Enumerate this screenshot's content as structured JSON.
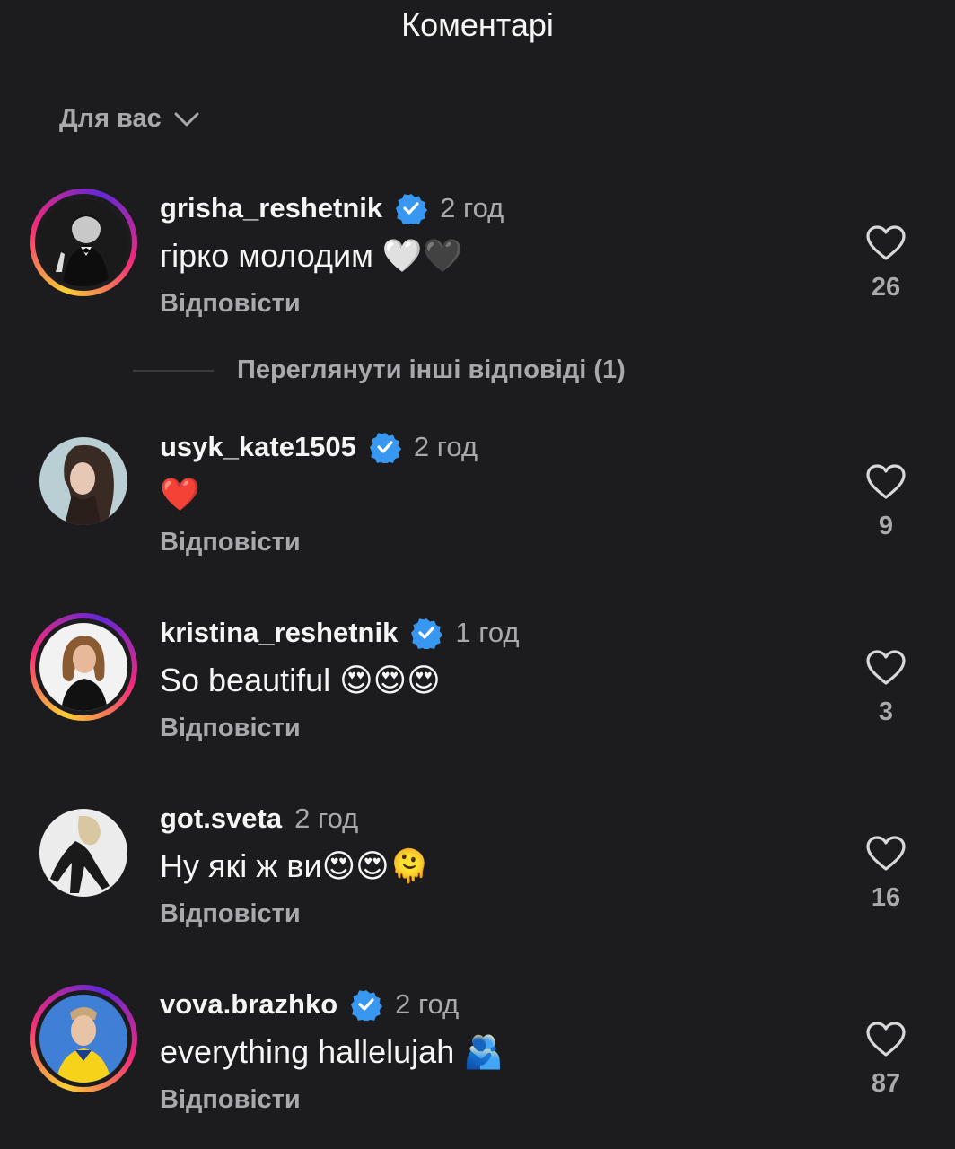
{
  "header": {
    "title": "Коментарі"
  },
  "sort": {
    "label": "Для вас"
  },
  "more_replies": "Переглянути інші відповіді (1)",
  "comments": [
    {
      "username": "grisha_reshetnik",
      "verified": true,
      "time": "2 год",
      "text": "гірко молодим 🤍🖤",
      "reply": "Відповісти",
      "likes": "26"
    },
    {
      "username": "usyk_kate1505",
      "verified": true,
      "time": "2 год",
      "text": "❤️",
      "reply": "Відповісти",
      "likes": "9"
    },
    {
      "username": "kristina_reshetnik",
      "verified": true,
      "time": "1 год",
      "text": "So beautiful 😍😍😍",
      "reply": "Відповісти",
      "likes": "3"
    },
    {
      "username": "got.sveta",
      "verified": false,
      "time": "2 год",
      "text": "Ну які ж ви😍😍🫠",
      "reply": "Відповісти",
      "likes": "16"
    },
    {
      "username": "vova.brazhko",
      "verified": true,
      "time": "2 год",
      "text": "everything hallelujah 🫂",
      "reply": "Відповісти",
      "likes": "87"
    }
  ]
}
